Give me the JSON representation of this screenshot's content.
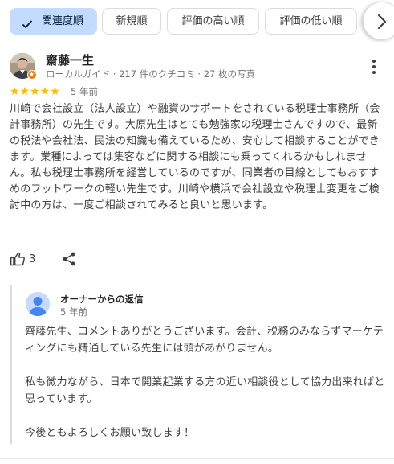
{
  "sort_chips": [
    {
      "label": "関連度順",
      "selected": true
    },
    {
      "label": "新規順",
      "selected": false
    },
    {
      "label": "評価の高い順",
      "selected": false
    },
    {
      "label": "評価の低い順",
      "selected": false
    }
  ],
  "review": {
    "reviewer_name": "齋藤一生",
    "reviewer_meta": "ローカルガイド · 217 件のクチコミ · 27 枚の写真",
    "rating": 5,
    "stars_text": "★★★★★",
    "date": "5 年前",
    "text": "川崎で会社設立（法人設立）や融資のサポートをされている税理士事務所（会計事務所）の先生です。大原先生はとても勉強家の税理士さんですので、最新の税法や会社法、民法の知識も備えているため、安心して相談することができます。業種によっては集客などに関する相談にも乗ってくれるかもしれません。私も税理士事務所を経営しているのですが、同業者の目線としてもおすすめのフットワークの軽い先生です。川崎や横浜で会社設立や税理士変更をご検討中の方は、一度ご相談されてみると良いと思います。",
    "like_count": "3"
  },
  "owner_reply": {
    "title": "オーナーからの返信",
    "date": "5 年前",
    "text": "齊藤先生、コメントありがとうございます。会計、税務のみならずマーケティングにも精通している先生には頭があがりません。\n\n私も微力ながら、日本で開業起業する方の近い相談役として協力出来ればと思っています。\n\n今後ともよろしくお願い致します！"
  },
  "colors": {
    "selected_chip_bg": "#c2dbff",
    "star_color": "#fbbc04",
    "local_guide_badge": "#f57c00"
  },
  "icons": {
    "chip_check": "check-icon",
    "scroll_next": "chevron-right-icon",
    "more": "more-vert-icon",
    "like": "thumb-up-icon",
    "share": "share-icon"
  }
}
